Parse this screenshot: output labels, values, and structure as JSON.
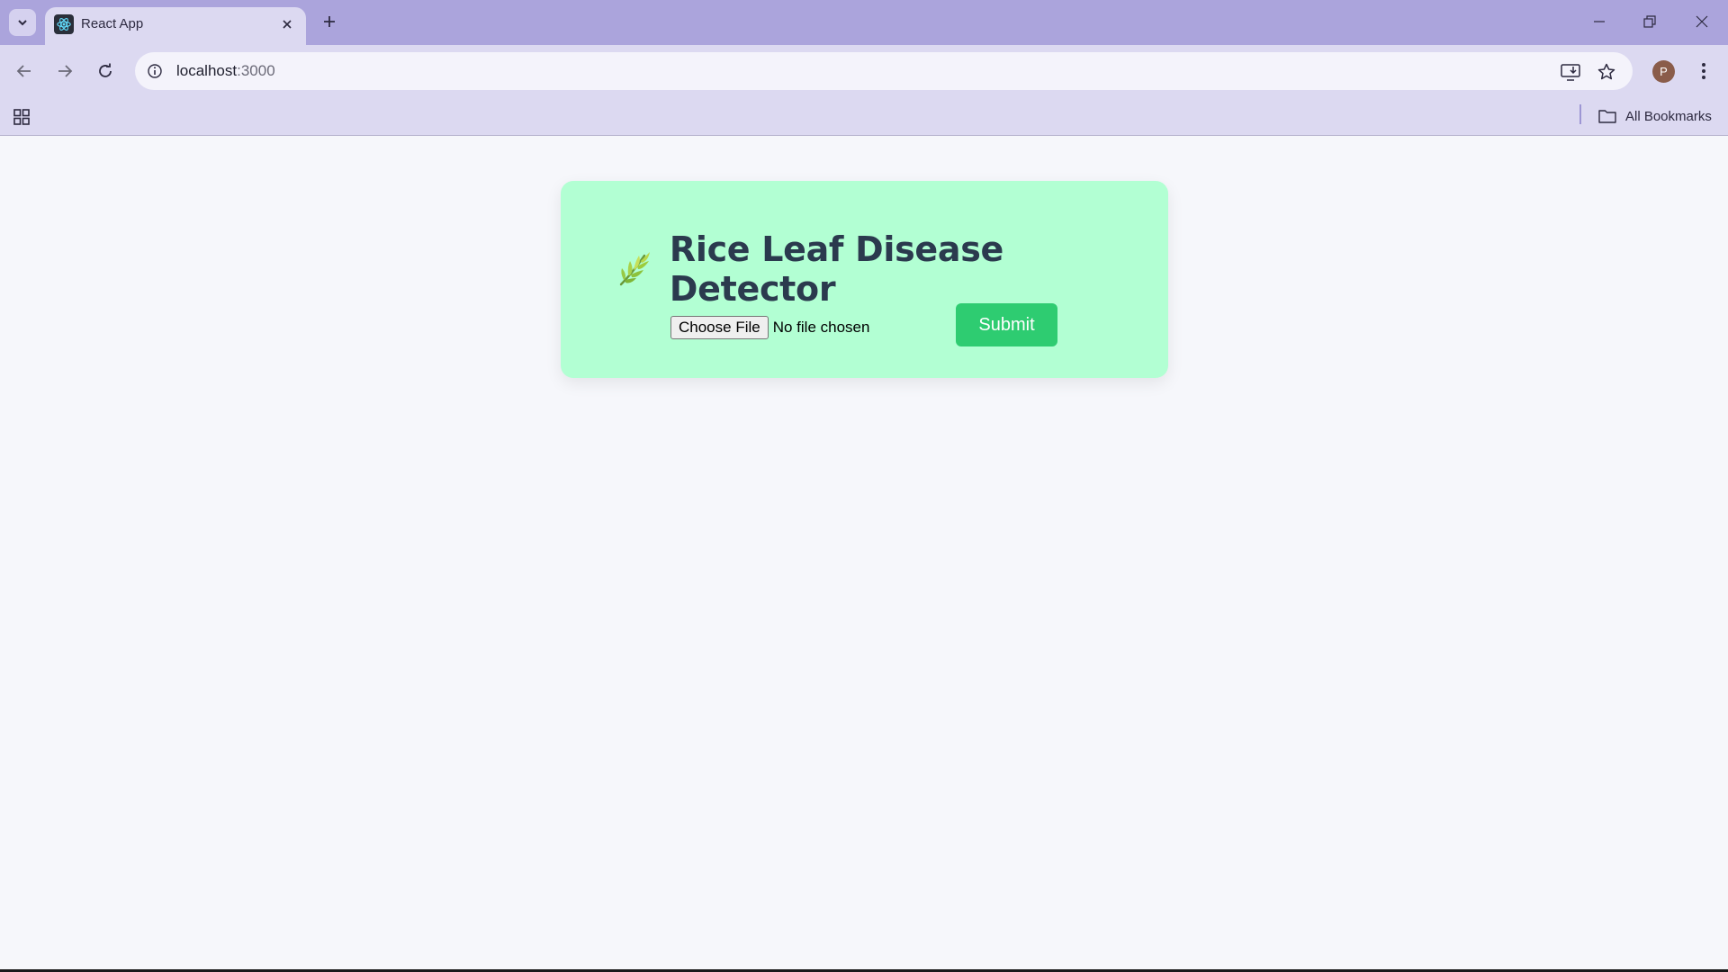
{
  "browser": {
    "tab": {
      "title": "React App"
    },
    "address_bar": {
      "host": "localhost",
      "port": ":3000"
    },
    "profile_initial": "P",
    "bookmarks_bar": {
      "all_bookmarks_label": "All Bookmarks"
    },
    "icons": [
      "tab-search-icon",
      "react-favicon-icon",
      "close-icon",
      "plus-icon",
      "minimize-icon",
      "restore-icon",
      "close-window-icon",
      "back-arrow-icon",
      "forward-arrow-icon",
      "reload-icon",
      "info-icon",
      "install-app-icon",
      "star-icon",
      "more-vert-icon",
      "apps-grid-icon",
      "folder-icon"
    ]
  },
  "page": {
    "title": "Rice Leaf Disease Detector",
    "title_icon": "herb-leaf-icon",
    "file_input": {
      "button_label": "Choose File",
      "status": "No file chosen"
    },
    "submit_label": "Submit"
  },
  "colors": {
    "card_background": "#b2ffd3",
    "submit_button": "#2ecc71",
    "title_text": "#2b3a4e",
    "tabstrip": "#aba4dc",
    "toolbar": "#dcd9f1"
  }
}
